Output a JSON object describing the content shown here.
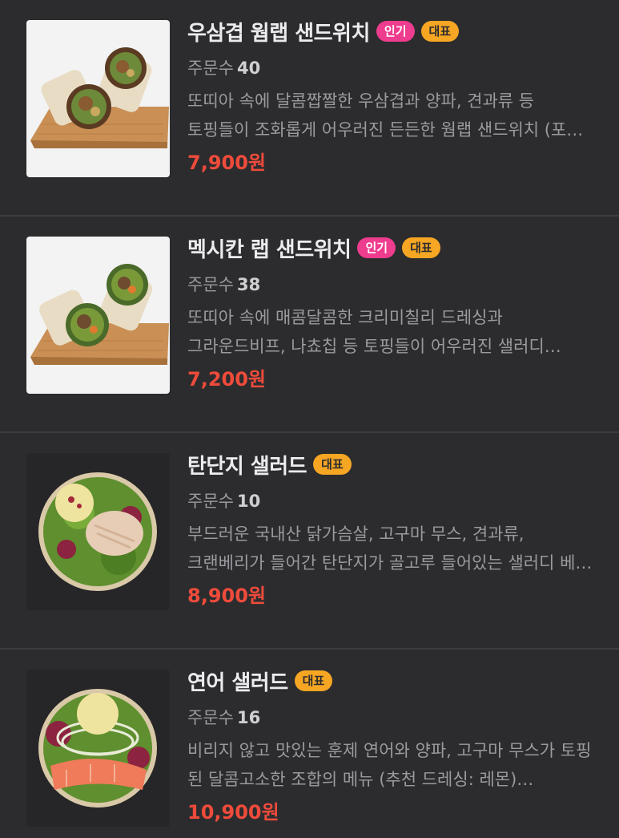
{
  "menu_items": [
    {
      "name": "우삼겹 웜랩 샌드위치",
      "badge_popular": "인기",
      "badge_rep": "대표",
      "orders_label": "주문수",
      "orders_count": "40",
      "description": "또띠아 속에 달콤짭짤한 우삼겹과 양파, 견과류 등 토핑들이 조화롭게 어우러진 든든한 웜랩 샌드위치 (포…",
      "price": "7,900원",
      "image": "wrap-sandwich-image"
    },
    {
      "name": "멕시칸 랩 샌드위치",
      "badge_popular": "인기",
      "badge_rep": "대표",
      "orders_label": "주문수",
      "orders_count": "38",
      "description": "또띠아 속에 매콤달콤한 크리미칠리 드레싱과 그라운드비프, 나쵸칩 등 토핑들이 어우러진 샐러디 스테디…",
      "price": "7,200원",
      "image": "wrap-sandwich-image"
    },
    {
      "name": "탄단지 샐러드",
      "badge_rep": "대표",
      "orders_label": "주문수",
      "orders_count": "10",
      "description": "부드러운 국내산 닭가슴살, 고구마 무스, 견과류, 크랜베리가 들어간 탄단지가 골고루 들어있는 샐러디 베…",
      "price": "8,900원",
      "image": "chicken-salad-image"
    },
    {
      "name": "연어 샐러드",
      "badge_rep": "대표",
      "orders_label": "주문수",
      "orders_count": "16",
      "description": "비리지 않고 맛있는 훈제 연어와 양파, 고구마 무스가 토핑 된 달콤고소한 조합의 메뉴 (추천 드레싱: 레몬)…",
      "price": "10,900원",
      "image": "salmon-salad-image"
    }
  ],
  "colors": {
    "background": "#2c2c2e",
    "price": "#ef4b3b",
    "badge_popular": "#ee3c8e",
    "badge_rep": "#f6a623"
  }
}
